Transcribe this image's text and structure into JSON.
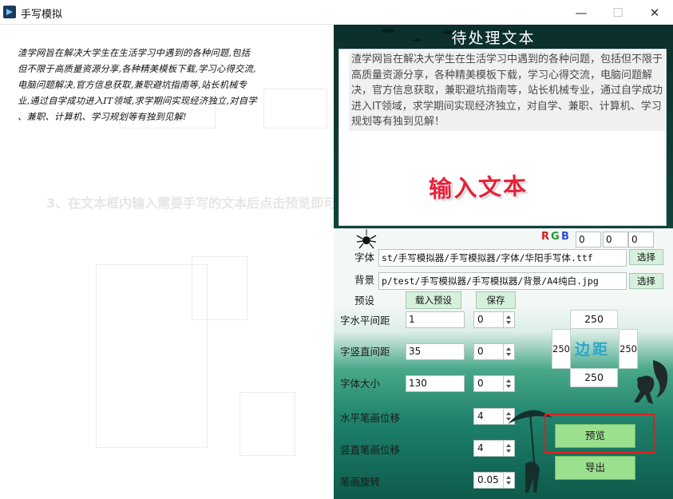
{
  "window": {
    "title": "手写模拟"
  },
  "preview": {
    "handwritten_lines": [
      "渣学网旨在解决大学生在生活学习中遇到的各种问题,包括",
      "但不限于高质量资源分享,各种精美模板下载,学习心得交流,",
      "电脑问题解决,官方信息获取,兼职避坑指南等,站长机械专",
      "业,通过自学成功进入IT领域,求学期间实现经济独立,对自学",
      "、兼职、计算机、学习规划等有独到见解!"
    ],
    "background_instruction": "3、在文本框内输入需要手写的文本后点击预览即可查看效果"
  },
  "panel": {
    "section_title": "待处理文本",
    "input_text": "渣学网旨在解决大学生在生活学习中遇到的各种问题，包括但不限于高质量资源分享，各种精美模板下载，学习心得交流，电脑问题解决，官方信息获取，兼职避坑指南等，站长机械专业，通过自学成功进入IT领域，求学期间实现经济独立，对自学、兼职、计算机、学习规划等有独到见解！",
    "input_hint": "输入文本",
    "rgb": {
      "r_letter": "R",
      "g_letter": "G",
      "b_letter": "B",
      "r": "0",
      "g": "0",
      "b": "0",
      "r_color": "#d62020",
      "g_color": "#1f9b2a",
      "b_color": "#2b4bd6"
    },
    "font": {
      "label": "字体",
      "path": "st/手写模拟器/手写模拟器/字体/华阳手写体.ttf",
      "button": "选择"
    },
    "background": {
      "label": "背景",
      "path": "p/test/手写模拟器/手写模拟器/背景/A4纯白.jpg",
      "button": "选择"
    },
    "preset": {
      "label": "预设",
      "load_button": "载入预设",
      "save_button": "保存"
    },
    "h_spacing": {
      "label": "字水平间距",
      "value": "1",
      "offset": "0"
    },
    "v_spacing": {
      "label": "字竖直间距",
      "value": "35",
      "offset": "0"
    },
    "font_size": {
      "label": "字体大小",
      "value": "130",
      "offset": "0"
    },
    "margin": {
      "label": "边距",
      "top": "250",
      "left": "250",
      "right": "250",
      "bottom": "250"
    },
    "h_stroke": {
      "label": "水平笔画位移",
      "value": "4"
    },
    "v_stroke": {
      "label": "竖直笔画位移",
      "value": "4"
    },
    "stroke_rot": {
      "label": "笔画旋转",
      "value": "0.05"
    },
    "preview_button": "预览",
    "export_button": "导出",
    "highlight_color": "#e0201e"
  }
}
